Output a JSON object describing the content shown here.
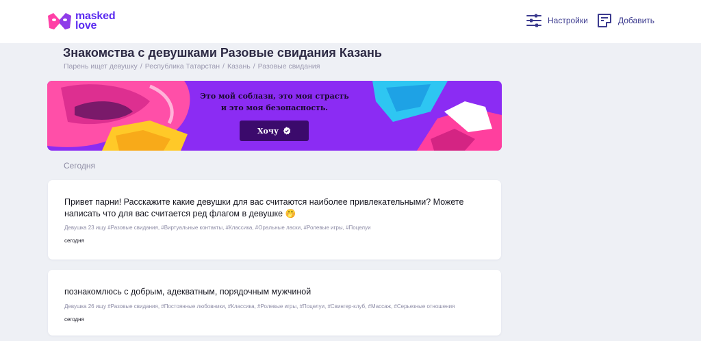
{
  "header": {
    "logo": {
      "line1": "masked",
      "line2": "love"
    },
    "nav": [
      {
        "label": "Настройки",
        "icon": "sliders-icon"
      },
      {
        "label": "Добавить",
        "icon": "add-post-icon"
      }
    ]
  },
  "page": {
    "title": "Знакомства с девушками Разовые свидания Казань",
    "breadcrumb": [
      "Парень ищет девушку",
      "Республика Татарстан",
      "Казань",
      "Разовые свидания"
    ]
  },
  "banner": {
    "line1": "Это мой соблазн, это моя страсть",
    "line2": "и это моя безопасность.",
    "button": "Хочу"
  },
  "section": {
    "label": "Сегодня"
  },
  "posts": [
    {
      "text": "Привет парни! Расскажите какие девушки для вас считаются наиболее привлекательными? Можете написать что для вас считается ред флагом в девушке 🤭",
      "meta": "Девушка 23 ищу #Разовые свидания, #Виртуальные контакты, #Классика, #Оральные ласки, #Ролевые игры, #Поцелуи",
      "time": "сегодня"
    },
    {
      "text": "познакомлюсь с добрым, адекватным, порядочным мужчиной",
      "meta": "Девушка 26 ищу #Разовые свидания, #Постоянные любовники, #Классика, #Ролевые игры, #Поцелуи, #Свингер-клуб, #Массаж, #Серьезные отношения",
      "time": "сегодня"
    }
  ],
  "colors": {
    "brand": "#5b2cf0",
    "brand_pink": "#ff3fa6",
    "banner_bg": "#8b2cf3",
    "banner_button": "#3b0a6c",
    "page_bg": "#eef0f5"
  }
}
